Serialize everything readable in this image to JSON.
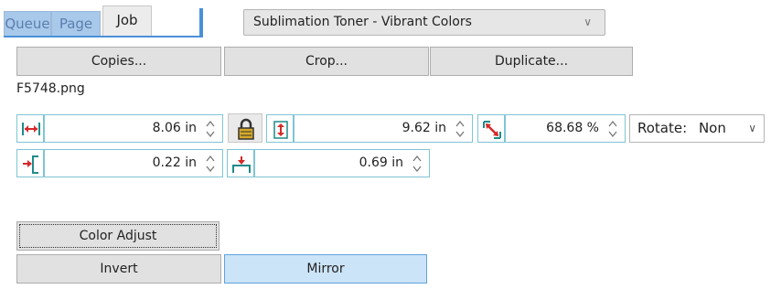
{
  "tabs": [
    {
      "label": "Queue"
    },
    {
      "label": "Page"
    },
    {
      "label": "Job",
      "active": true
    }
  ],
  "profile_select": {
    "value": "Sublimation Toner - Vibrant Colors"
  },
  "actions": {
    "copies": "Copies...",
    "crop": "Crop...",
    "duplicate": "Duplicate..."
  },
  "filename": "F5748.png",
  "size": {
    "width": "8.06 in",
    "height": "9.62 in",
    "scale": "68.68 %"
  },
  "rotate": {
    "label": "Rotate:",
    "value": "Non"
  },
  "offset": {
    "left": "0.22 in",
    "top": "0.69 in"
  },
  "buttons": {
    "color_adjust": "Color Adjust",
    "invert": "Invert",
    "mirror": "Mirror"
  },
  "icons": {
    "width": "horizontal-resize-icon",
    "lock": "padlock-icon",
    "height": "vertical-resize-icon",
    "scale": "diagonal-scale-icon",
    "offset_left": "left-offset-icon",
    "offset_top": "top-offset-icon"
  },
  "colors": {
    "accent": "#4a90d9",
    "icon_red": "#d62828",
    "icon_teal": "#1f8a8a",
    "field_border": "#7fc4d6",
    "pressed_bg": "#cce4f7"
  }
}
